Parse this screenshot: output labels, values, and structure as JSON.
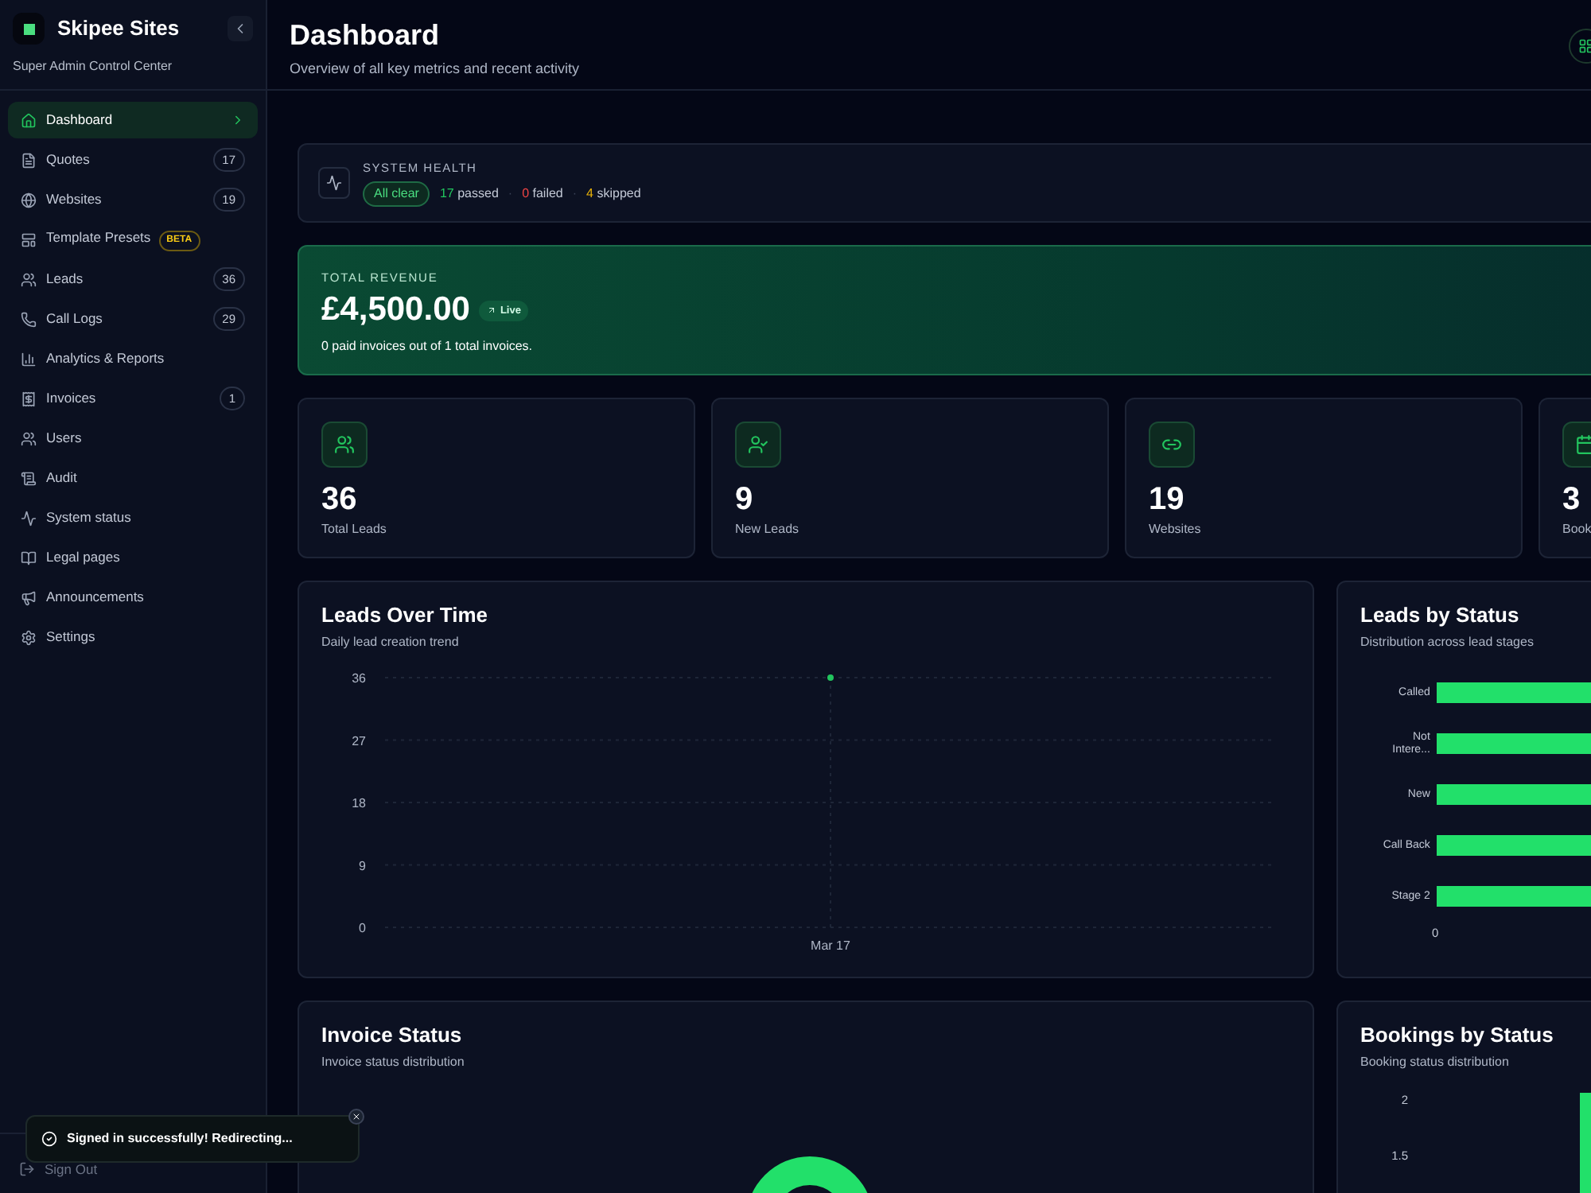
{
  "sidebar": {
    "brand": "Skipee Sites",
    "subtitle": "Super Admin Control Center",
    "items": [
      {
        "label": "Dashboard",
        "selected": true
      },
      {
        "label": "Quotes",
        "count": "17",
        "selected": false
      },
      {
        "label": "Websites",
        "count": "19",
        "selected": false
      },
      {
        "label": "Template Presets",
        "badge": "BETA",
        "selected": false
      },
      {
        "label": "Leads",
        "count": "36",
        "selected": false
      },
      {
        "label": "Call Logs",
        "count": "29",
        "selected": false
      },
      {
        "label": "Analytics & Reports",
        "selected": false
      },
      {
        "label": "Invoices",
        "count": "1",
        "selected": false
      },
      {
        "label": "Users",
        "selected": false
      },
      {
        "label": "Audit",
        "selected": false
      },
      {
        "label": "System status",
        "selected": false
      },
      {
        "label": "Legal pages",
        "selected": false
      },
      {
        "label": "Announcements",
        "selected": false
      },
      {
        "label": "Settings",
        "selected": false
      }
    ],
    "sign_out": "Sign Out"
  },
  "header": {
    "title": "Dashboard",
    "subtitle": "Overview of all key metrics and recent activity"
  },
  "system_health": {
    "title": "SYSTEM HEALTH",
    "status": "All clear",
    "passed": "17",
    "passed_label": "passed",
    "separator": "·",
    "failed": "0",
    "failed_label": "failed",
    "skipped": "4",
    "skipped_label": "skipped"
  },
  "revenue": {
    "title": "TOTAL REVENUE",
    "amount": "£4,500.00",
    "badge": "Live",
    "note": "0 paid invoices out of 1 total invoices."
  },
  "stats": [
    {
      "value": "36",
      "label": "Total Leads"
    },
    {
      "value": "9",
      "label": "New Leads"
    },
    {
      "value": "19",
      "label": "Websites"
    },
    {
      "value": "3",
      "label": "Book"
    }
  ],
  "leads_over_time": {
    "title": "Leads Over Time",
    "subtitle": "Daily lead creation trend",
    "chart_data": {
      "type": "line",
      "categories": [
        "Mar 17"
      ],
      "series": [
        {
          "color": "#22c55e",
          "marker": true,
          "values": [
            36
          ]
        }
      ],
      "grid": true,
      "ylim": [
        0,
        36
      ],
      "yticks": [
        0,
        9,
        18,
        27,
        36
      ]
    }
  },
  "leads_by_status": {
    "title": "Leads by Status",
    "subtitle": "Distribution across lead stages",
    "categories": [
      "Called",
      "Not Intere...",
      "New",
      "Call Back",
      "Stage 2"
    ],
    "axis_label": "0"
  },
  "invoice_status": {
    "title": "Invoice Status",
    "subtitle": "Invoice status distribution"
  },
  "bookings_by_status": {
    "title": "Bookings by Status",
    "subtitle": "Booking status distribution",
    "ticks": [
      "2",
      "1.5"
    ]
  },
  "toast": {
    "message": "Signed in successfully! Redirecting..."
  }
}
